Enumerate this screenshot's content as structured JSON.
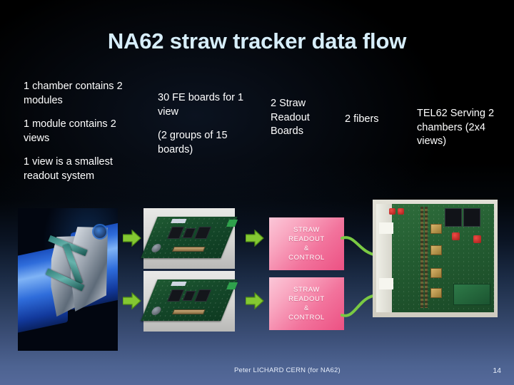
{
  "slide": {
    "title": "NA62 straw tracker data flow",
    "title_color": "#d7eefa",
    "background_top_color": "#000000",
    "background_bottom_color": "#55699a"
  },
  "text_blocks": {
    "chamber": {
      "line1": "1 chamber contains 2 modules",
      "line2": "1 module contains 2 views",
      "line3": "1 view is a smallest readout system"
    },
    "fe_boards": {
      "line1": "30 FE boards for 1 view",
      "line2": "(2 groups of 15 boards)"
    },
    "straw_readout_boards": {
      "line1": "2  Straw Readout Boards"
    },
    "fibers": {
      "line1": "2  fibers"
    },
    "tel62": {
      "line1": "TEL62 Serving 2 chambers (2x4 views)"
    }
  },
  "flow_blocks": {
    "pink_color": "#f2739c",
    "arrow_color": "#7ac943",
    "items": [
      {
        "id": "straw-readout-control-1",
        "line1": "STRAW",
        "line2": "READOUT",
        "line3": "&",
        "line4": "CONTROL"
      },
      {
        "id": "straw-readout-control-2",
        "line1": "STRAW",
        "line2": "READOUT",
        "line3": "&",
        "line4": "CONTROL"
      }
    ]
  },
  "images": {
    "chamber_cad": "straw-chamber-cad-rendering",
    "fe_board_photo_1": "front-end-board-photo",
    "fe_board_photo_2": "front-end-board-photo",
    "tel62_photo": "tel62-board-photo"
  },
  "icons": {
    "arrow_right_1": "green-arrow-right-icon",
    "arrow_right_2": "green-arrow-right-icon",
    "arrow_right_3": "green-arrow-right-icon",
    "arrow_right_4": "green-arrow-right-icon",
    "curved_arrow_1": "green-curved-arrow-icon",
    "curved_arrow_2": "green-curved-arrow-icon",
    "cern_logo": "cern-logo-icon"
  },
  "footer": {
    "author": "Peter LICHARD CERN (for NA62)",
    "page_number": "14"
  }
}
